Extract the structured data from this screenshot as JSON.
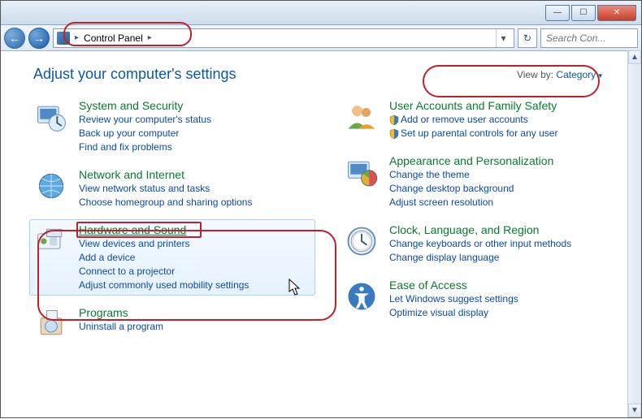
{
  "window": {
    "minimize": "—",
    "maximize": "☐",
    "close": "✕"
  },
  "nav": {
    "back_arrow": "←",
    "forward_arrow": "→",
    "breadcrumb_root": "Control Panel",
    "breadcrumb_sep": "▸",
    "dropdown_arrow": "▾",
    "refresh": "↻"
  },
  "search": {
    "placeholder": "Search Con..."
  },
  "heading": "Adjust your computer's settings",
  "viewby": {
    "label": "View by:",
    "value": "Category",
    "arrow": "▾"
  },
  "categories": {
    "system_security": {
      "title": "System and Security",
      "tasks": [
        "Review your computer's status",
        "Back up your computer",
        "Find and fix problems"
      ]
    },
    "network": {
      "title": "Network and Internet",
      "tasks": [
        "View network status and tasks",
        "Choose homegroup and sharing options"
      ]
    },
    "hardware": {
      "title": "Hardware and Sound",
      "tasks": [
        "View devices and printers",
        "Add a device",
        "Connect to a projector",
        "Adjust commonly used mobility settings"
      ]
    },
    "programs": {
      "title": "Programs",
      "tasks": [
        "Uninstall a program"
      ]
    },
    "users": {
      "title": "User Accounts and Family Safety",
      "tasks": [
        "Add or remove user accounts",
        "Set up parental controls for any user"
      ],
      "shielded": [
        true,
        true
      ]
    },
    "appearance": {
      "title": "Appearance and Personalization",
      "tasks": [
        "Change the theme",
        "Change desktop background",
        "Adjust screen resolution"
      ]
    },
    "clock": {
      "title": "Clock, Language, and Region",
      "tasks": [
        "Change keyboards or other input methods",
        "Change display language"
      ]
    },
    "ease": {
      "title": "Ease of Access",
      "tasks": [
        "Let Windows suggest settings",
        "Optimize visual display"
      ]
    }
  }
}
